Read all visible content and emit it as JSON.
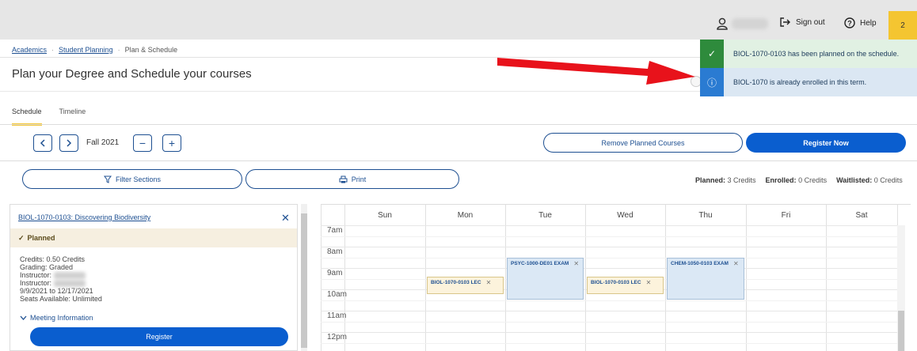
{
  "header": {
    "sign_out": "Sign out",
    "help": "Help",
    "notification_count": "2"
  },
  "breadcrumb": {
    "items": [
      "Academics",
      "Student Planning",
      "Plan & Schedule"
    ]
  },
  "page": {
    "title": "Plan your Degree and Schedule your courses"
  },
  "tabs": [
    {
      "label": "Schedule",
      "active": true
    },
    {
      "label": "Timeline",
      "active": false
    }
  ],
  "toolbar": {
    "prev_icon": "chevron-left-icon",
    "next_icon": "chevron-right-icon",
    "term": "Fall 2021",
    "remove_term": "−",
    "add_term": "+",
    "remove_planned": "Remove Planned Courses",
    "register_now": "Register Now",
    "filter_sections": "Filter Sections",
    "print": "Print"
  },
  "credits": {
    "planned_label": "Planned:",
    "planned_value": "3 Credits",
    "enrolled_label": "Enrolled:",
    "enrolled_value": "0 Credits",
    "waitlisted_label": "Waitlisted:",
    "waitlisted_value": "0 Credits"
  },
  "course_card": {
    "title": "BIOL-1070-0103: Discovering Biodiversity",
    "status": "Planned",
    "credits": "Credits: 0.50 Credits",
    "grading": "Grading: Graded",
    "instructor_label": "Instructor:",
    "dates": "9/9/2021 to 12/17/2021",
    "seats": "Seats Available:  Unlimited",
    "meeting_info": "Meeting Information",
    "register": "Register"
  },
  "calendar": {
    "days": [
      "Sun",
      "Mon",
      "Tue",
      "Wed",
      "Thu",
      "Fri",
      "Sat"
    ],
    "times": [
      "7am",
      "8am",
      "9am",
      "10am",
      "11am",
      "12pm"
    ],
    "events": [
      {
        "label": "BIOL-1070-0103 LEC",
        "day": "Mon",
        "kind": "lecture"
      },
      {
        "label": "PSYC-1000-DE01 EXAM",
        "day": "Tue",
        "kind": "exam"
      },
      {
        "label": "BIOL-1070-0103 LEC",
        "day": "Wed",
        "kind": "lecture"
      },
      {
        "label": "CHEM-1050-0103 EXAM",
        "day": "Thu",
        "kind": "exam"
      }
    ]
  },
  "notifications": [
    {
      "type": "success",
      "message": "BIOL-1070-0103 has been planned on the schedule."
    },
    {
      "type": "info",
      "message": "BIOL-1070 is already enrolled in this term."
    }
  ],
  "colors": {
    "primary": "#0a5ecf",
    "link": "#1d4f91",
    "accent": "#f4c531",
    "success": "#2e8b3c",
    "info": "#2a7bd2",
    "annotation_arrow": "#e8121b"
  }
}
